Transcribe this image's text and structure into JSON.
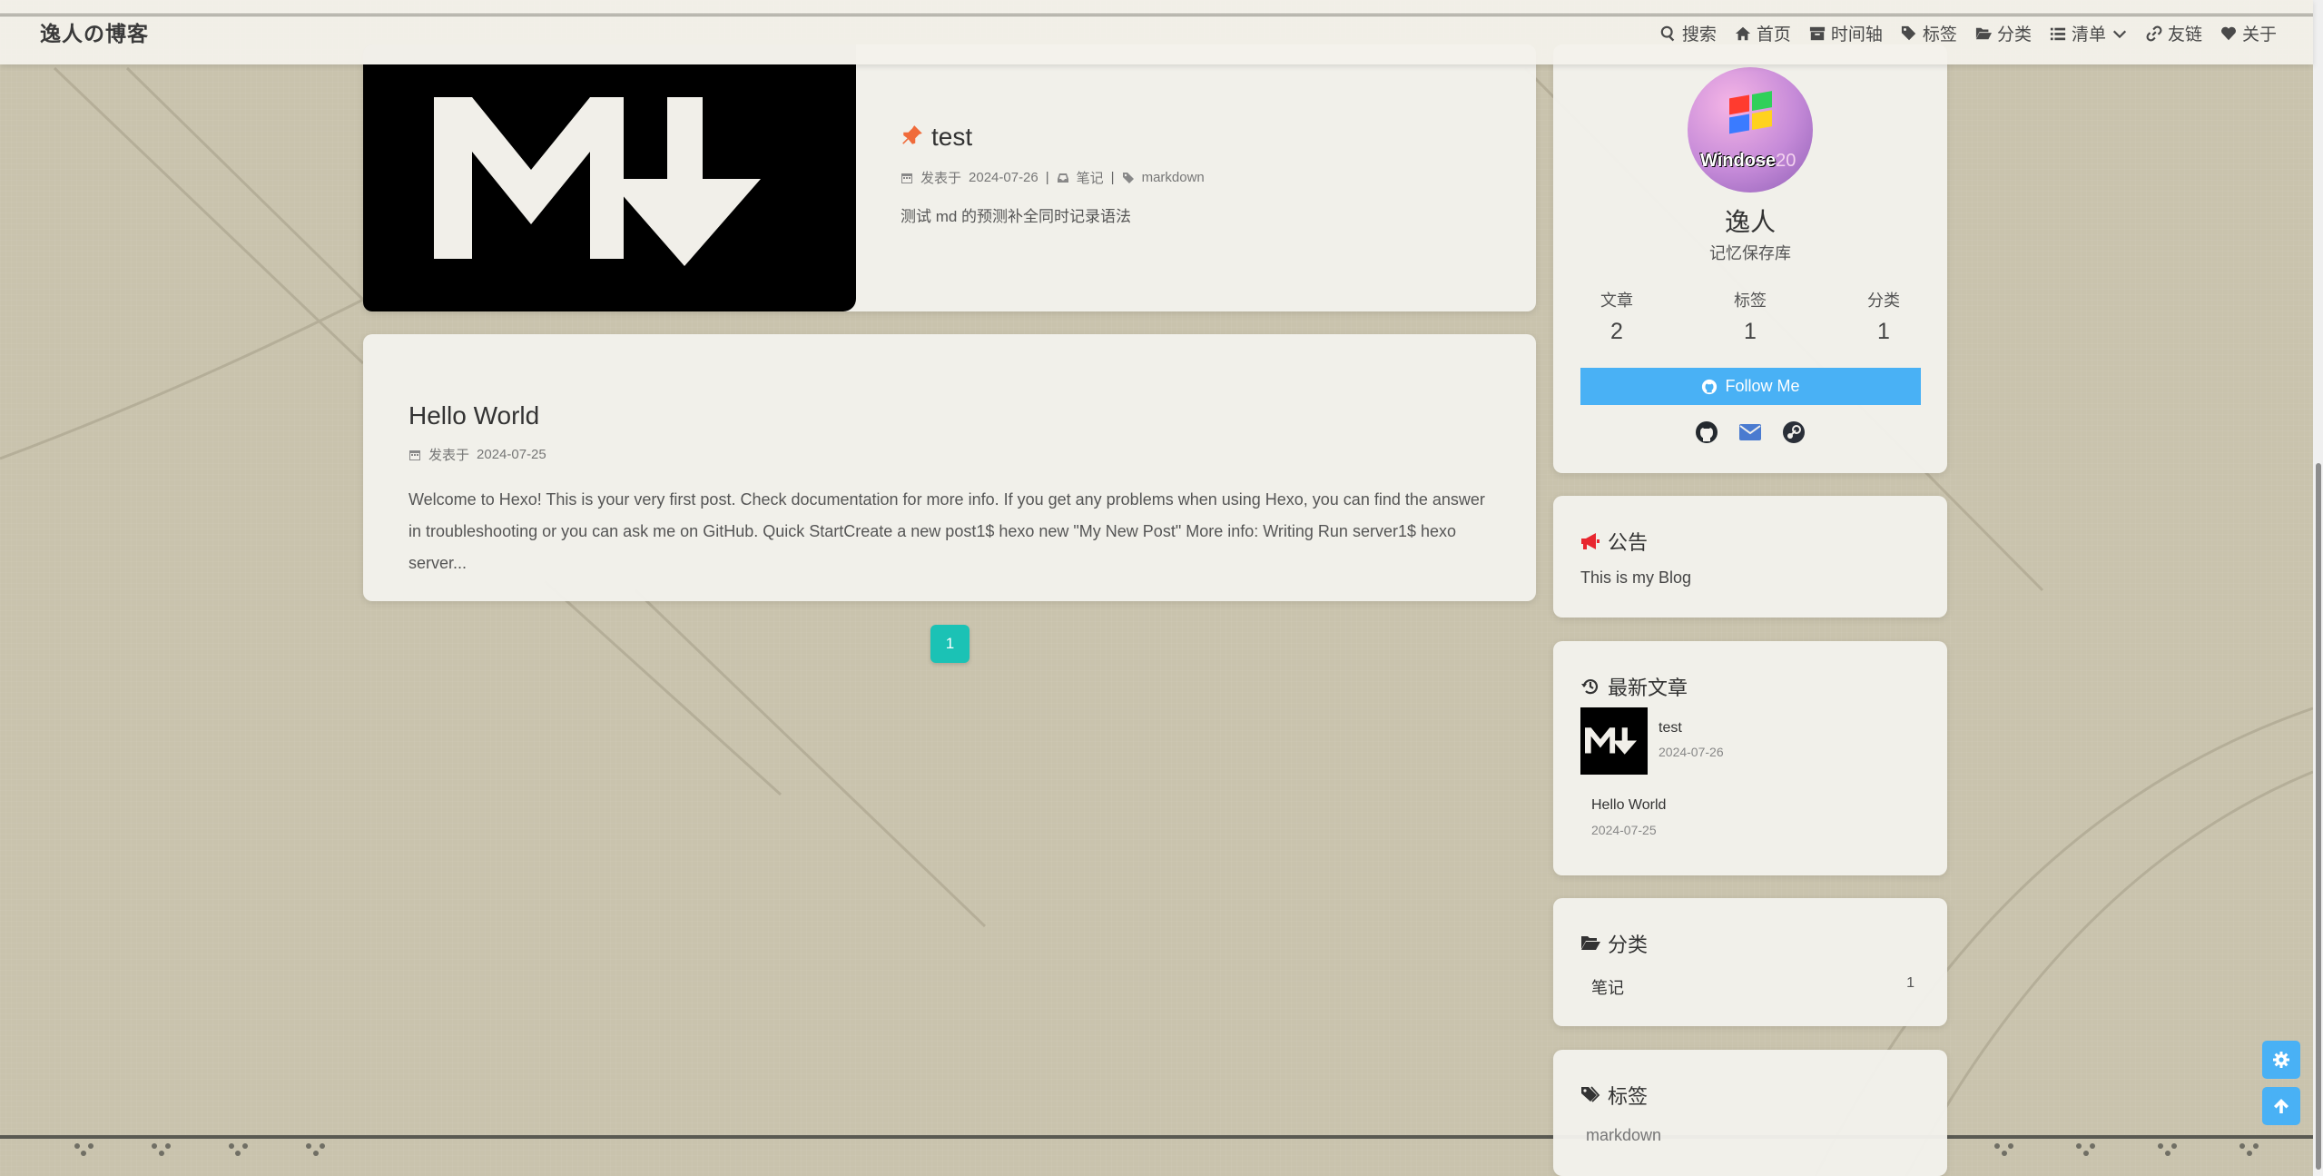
{
  "site": {
    "title": "逸人の博客"
  },
  "nav": {
    "search": "搜索",
    "home": "首页",
    "timeline": "时间轴",
    "tags": "标签",
    "categories": "分类",
    "list": "清单",
    "links": "友链",
    "about": "关于"
  },
  "posts": [
    {
      "title": "test",
      "meta_prefix": "发表于",
      "date": "2024-07-26",
      "separator": "|",
      "category": "笔记",
      "tag": "markdown",
      "excerpt": "测试 md 的预测补全同时记录语法"
    },
    {
      "title": "Hello World",
      "meta_prefix": "发表于",
      "date": "2024-07-25",
      "excerpt": "Welcome to Hexo! This is your very first post. Check documentation for more info. If you get any problems when using Hexo, you can find the answer in troubleshooting or you can ask me on GitHub. Quick StartCreate a new post1$ hexo new \"My New Post\" More info: Writing Run server1$ hexo server..."
    }
  ],
  "pagination": {
    "current": "1"
  },
  "profile": {
    "avatar_text": "Windose",
    "avatar_number": "20",
    "name": "逸人",
    "description": "记忆保存库",
    "stats": [
      {
        "label": "文章",
        "value": "2"
      },
      {
        "label": "标签",
        "value": "1"
      },
      {
        "label": "分类",
        "value": "1"
      }
    ],
    "follow_label": "Follow Me",
    "socials": [
      "github-icon",
      "envelope-icon",
      "steam-icon"
    ]
  },
  "announcement": {
    "title": "公告",
    "text": "This is my Blog"
  },
  "recent": {
    "title": "最新文章",
    "items": [
      {
        "title": "test",
        "date": "2024-07-26"
      },
      {
        "title": "Hello World",
        "date": "2024-07-25"
      }
    ]
  },
  "categories": {
    "title": "分类",
    "items": [
      {
        "name": "笔记",
        "count": "1"
      }
    ]
  },
  "tags": {
    "title": "标签",
    "items": [
      "markdown"
    ]
  },
  "colors": {
    "accent": "#49b1f5",
    "pager": "#1bc2b5",
    "pin": "#f06b3a",
    "background": "#c9c3ad"
  }
}
